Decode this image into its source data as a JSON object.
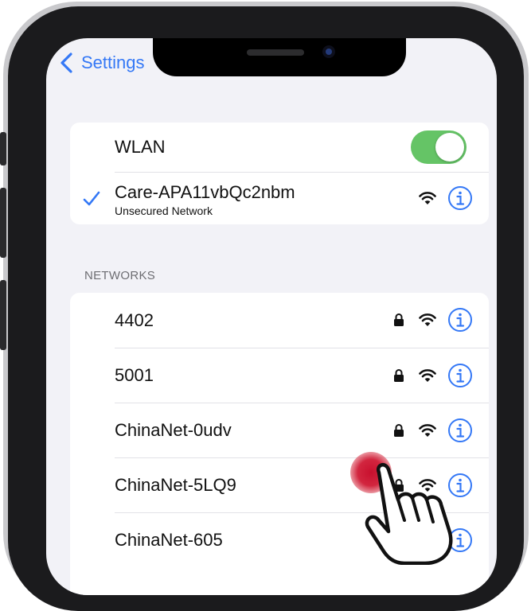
{
  "nav": {
    "back_label": "Settings"
  },
  "wlan": {
    "label": "WLAN",
    "enabled": true,
    "connected": {
      "name": "Care-APA11vbQc2nbm",
      "subtitle": "Unsecured Network",
      "secured": false
    }
  },
  "networks": {
    "header": "NETWORKS",
    "items": [
      {
        "name": "4402",
        "secured": true
      },
      {
        "name": "5001",
        "secured": true
      },
      {
        "name": "ChinaNet-0udv",
        "secured": true
      },
      {
        "name": "ChinaNet-5LQ9",
        "secured": true
      },
      {
        "name": "ChinaNet-605",
        "secured": true
      }
    ]
  },
  "colors": {
    "accent": "#3478f6",
    "toggle_on": "#65c466",
    "tap_indicator": "#c8102e"
  },
  "icons": [
    "chevron-left-icon",
    "checkmark-icon",
    "lock-icon",
    "wifi-icon",
    "info-icon",
    "pointing-hand-icon"
  ]
}
